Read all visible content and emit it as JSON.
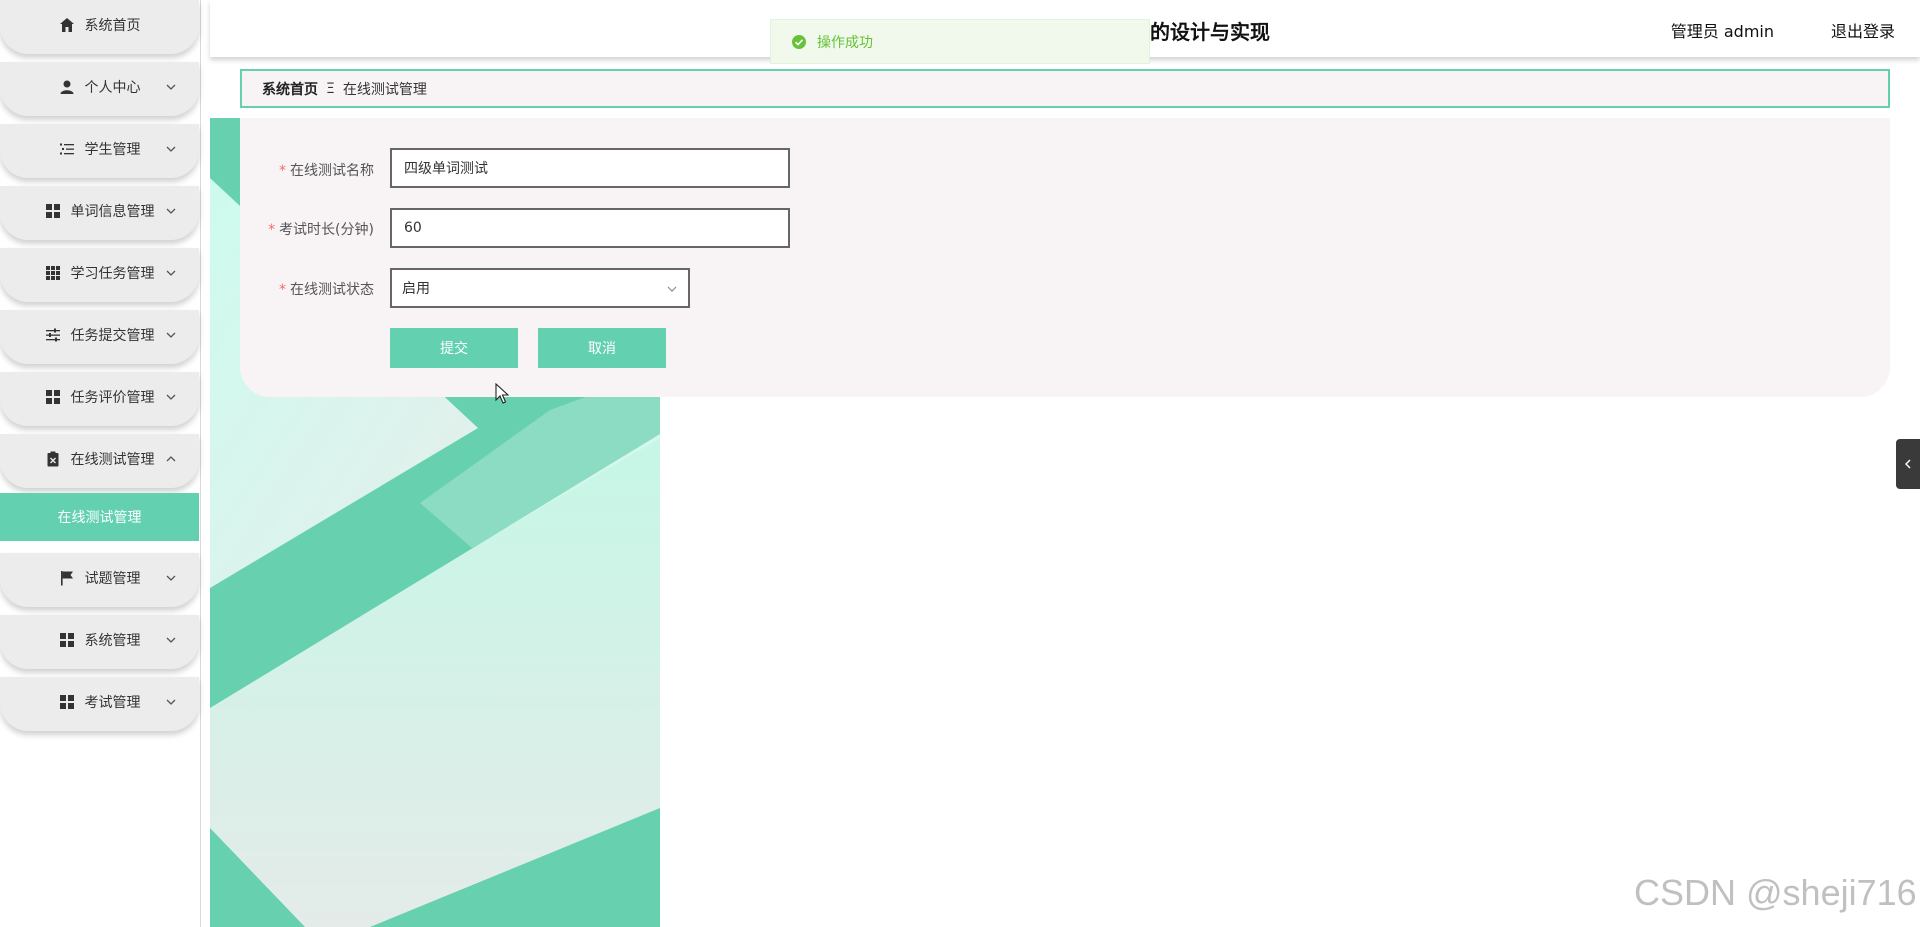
{
  "app": {
    "title": "的设计与实现",
    "user_label": "管理员 admin",
    "logout_label": "退出登录",
    "accent_color": "#63d0b0"
  },
  "toast": {
    "message": "操作成功",
    "icon": "check-circle-icon",
    "color": "#67c23a"
  },
  "sidebar": {
    "items": [
      {
        "label": "系统首页",
        "icon": "home-icon",
        "has_arrow": false
      },
      {
        "label": "个人中心",
        "icon": "user-icon",
        "has_arrow": true
      },
      {
        "label": "学生管理",
        "icon": "list-icon",
        "has_arrow": true
      },
      {
        "label": "单词信息管理",
        "icon": "grid-icon",
        "has_arrow": true
      },
      {
        "label": "学习任务管理",
        "icon": "dots-grid-icon",
        "has_arrow": true
      },
      {
        "label": "任务提交管理",
        "icon": "sliders-icon",
        "has_arrow": true
      },
      {
        "label": "任务评价管理",
        "icon": "grid-icon",
        "has_arrow": true
      },
      {
        "label": "在线测试管理",
        "icon": "clipboard-icon",
        "has_arrow": true,
        "expanded": true
      },
      {
        "label": "试题管理",
        "icon": "flag-icon",
        "has_arrow": true
      },
      {
        "label": "系统管理",
        "icon": "grid-icon",
        "has_arrow": true
      },
      {
        "label": "考试管理",
        "icon": "grid-icon",
        "has_arrow": true
      }
    ],
    "active_submenu": "在线测试管理"
  },
  "breadcrumb": {
    "home": "系统首页",
    "separator": "Ξ",
    "current": "在线测试管理"
  },
  "form": {
    "fields": [
      {
        "label": "在线测试名称",
        "value": "四级单词测试",
        "required": true
      },
      {
        "label": "考试时长(分钟)",
        "value": "60",
        "required": true
      },
      {
        "label": "在线测试状态",
        "value": "启用",
        "required": true
      }
    ],
    "submit_label": "提交",
    "cancel_label": "取消"
  },
  "watermark": "CSDN @sheji716"
}
